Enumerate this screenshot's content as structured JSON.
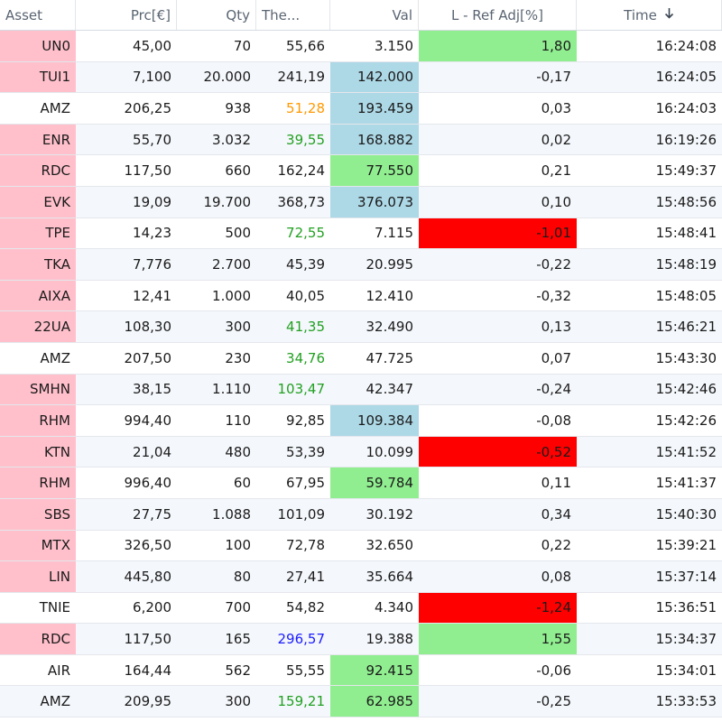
{
  "columns": [
    "Asset",
    "Prc[€]",
    "Qty",
    "The...",
    "Val",
    "L - Ref Adj[%]",
    "Time"
  ],
  "sort_icon": "arrow-down-icon",
  "colors": {
    "flag_pink": "#ffc0cb",
    "highlight_blue": "#add8e6",
    "highlight_green": "#90ee90",
    "highlight_red": "#ff0000",
    "text_orange": "#ff9900",
    "text_green": "#22a022",
    "text_blue": "#1c1cff"
  },
  "rows": [
    {
      "asset": "UN0",
      "price": "45,00",
      "qty": "70",
      "theo": "55,66",
      "val": "3.150",
      "ref": "1,80",
      "time": "16:24:08",
      "flag": "pink",
      "theo_color": "",
      "val_hl": "",
      "ref_hl": "green"
    },
    {
      "asset": "TUI1",
      "price": "7,100",
      "qty": "20.000",
      "theo": "241,19",
      "val": "142.000",
      "ref": "-0,17",
      "time": "16:24:05",
      "flag": "pink",
      "theo_color": "",
      "val_hl": "blue",
      "ref_hl": ""
    },
    {
      "asset": "AMZ",
      "price": "206,25",
      "qty": "938",
      "theo": "51,28",
      "val": "193.459",
      "ref": "0,03",
      "time": "16:24:03",
      "flag": "",
      "theo_color": "orange",
      "val_hl": "blue",
      "ref_hl": ""
    },
    {
      "asset": "ENR",
      "price": "55,70",
      "qty": "3.032",
      "theo": "39,55",
      "val": "168.882",
      "ref": "0,02",
      "time": "16:19:26",
      "flag": "pink",
      "theo_color": "green",
      "val_hl": "blue",
      "ref_hl": ""
    },
    {
      "asset": "RDC",
      "price": "117,50",
      "qty": "660",
      "theo": "162,24",
      "val": "77.550",
      "ref": "0,21",
      "time": "15:49:37",
      "flag": "pink",
      "theo_color": "",
      "val_hl": "green",
      "ref_hl": ""
    },
    {
      "asset": "EVK",
      "price": "19,09",
      "qty": "19.700",
      "theo": "368,73",
      "val": "376.073",
      "ref": "0,10",
      "time": "15:48:56",
      "flag": "pink",
      "theo_color": "",
      "val_hl": "blue",
      "ref_hl": ""
    },
    {
      "asset": "TPE",
      "price": "14,23",
      "qty": "500",
      "theo": "72,55",
      "val": "7.115",
      "ref": "-1,01",
      "time": "15:48:41",
      "flag": "pink",
      "theo_color": "green",
      "val_hl": "",
      "ref_hl": "red"
    },
    {
      "asset": "TKA",
      "price": "7,776",
      "qty": "2.700",
      "theo": "45,39",
      "val": "20.995",
      "ref": "-0,22",
      "time": "15:48:19",
      "flag": "pink",
      "theo_color": "",
      "val_hl": "",
      "ref_hl": ""
    },
    {
      "asset": "AIXA",
      "price": "12,41",
      "qty": "1.000",
      "theo": "40,05",
      "val": "12.410",
      "ref": "-0,32",
      "time": "15:48:05",
      "flag": "pink",
      "theo_color": "",
      "val_hl": "",
      "ref_hl": ""
    },
    {
      "asset": "22UA",
      "price": "108,30",
      "qty": "300",
      "theo": "41,35",
      "val": "32.490",
      "ref": "0,13",
      "time": "15:46:21",
      "flag": "pink",
      "theo_color": "green",
      "val_hl": "",
      "ref_hl": ""
    },
    {
      "asset": "AMZ",
      "price": "207,50",
      "qty": "230",
      "theo": "34,76",
      "val": "47.725",
      "ref": "0,07",
      "time": "15:43:30",
      "flag": "",
      "theo_color": "green",
      "val_hl": "",
      "ref_hl": ""
    },
    {
      "asset": "SMHN",
      "price": "38,15",
      "qty": "1.110",
      "theo": "103,47",
      "val": "42.347",
      "ref": "-0,24",
      "time": "15:42:46",
      "flag": "pink",
      "theo_color": "green",
      "val_hl": "",
      "ref_hl": ""
    },
    {
      "asset": "RHM",
      "price": "994,40",
      "qty": "110",
      "theo": "92,85",
      "val": "109.384",
      "ref": "-0,08",
      "time": "15:42:26",
      "flag": "pink",
      "theo_color": "",
      "val_hl": "blue",
      "ref_hl": ""
    },
    {
      "asset": "KTN",
      "price": "21,04",
      "qty": "480",
      "theo": "53,39",
      "val": "10.099",
      "ref": "-0,52",
      "time": "15:41:52",
      "flag": "pink",
      "theo_color": "",
      "val_hl": "",
      "ref_hl": "red"
    },
    {
      "asset": "RHM",
      "price": "996,40",
      "qty": "60",
      "theo": "67,95",
      "val": "59.784",
      "ref": "0,11",
      "time": "15:41:37",
      "flag": "pink",
      "theo_color": "",
      "val_hl": "green",
      "ref_hl": ""
    },
    {
      "asset": "SBS",
      "price": "27,75",
      "qty": "1.088",
      "theo": "101,09",
      "val": "30.192",
      "ref": "0,34",
      "time": "15:40:30",
      "flag": "pink",
      "theo_color": "",
      "val_hl": "",
      "ref_hl": ""
    },
    {
      "asset": "MTX",
      "price": "326,50",
      "qty": "100",
      "theo": "72,78",
      "val": "32.650",
      "ref": "0,22",
      "time": "15:39:21",
      "flag": "pink",
      "theo_color": "",
      "val_hl": "",
      "ref_hl": ""
    },
    {
      "asset": "LIN",
      "price": "445,80",
      "qty": "80",
      "theo": "27,41",
      "val": "35.664",
      "ref": "0,08",
      "time": "15:37:14",
      "flag": "pink",
      "theo_color": "",
      "val_hl": "",
      "ref_hl": ""
    },
    {
      "asset": "TNIE",
      "price": "6,200",
      "qty": "700",
      "theo": "54,82",
      "val": "4.340",
      "ref": "-1,24",
      "time": "15:36:51",
      "flag": "",
      "theo_color": "",
      "val_hl": "",
      "ref_hl": "red"
    },
    {
      "asset": "RDC",
      "price": "117,50",
      "qty": "165",
      "theo": "296,57",
      "val": "19.388",
      "ref": "1,55",
      "time": "15:34:37",
      "flag": "pink",
      "theo_color": "blue",
      "val_hl": "",
      "ref_hl": "green"
    },
    {
      "asset": "AIR",
      "price": "164,44",
      "qty": "562",
      "theo": "55,55",
      "val": "92.415",
      "ref": "-0,06",
      "time": "15:34:01",
      "flag": "",
      "theo_color": "",
      "val_hl": "green",
      "ref_hl": ""
    },
    {
      "asset": "AMZ",
      "price": "209,95",
      "qty": "300",
      "theo": "159,21",
      "val": "62.985",
      "ref": "-0,25",
      "time": "15:33:53",
      "flag": "",
      "theo_color": "green",
      "val_hl": "green",
      "ref_hl": ""
    }
  ]
}
